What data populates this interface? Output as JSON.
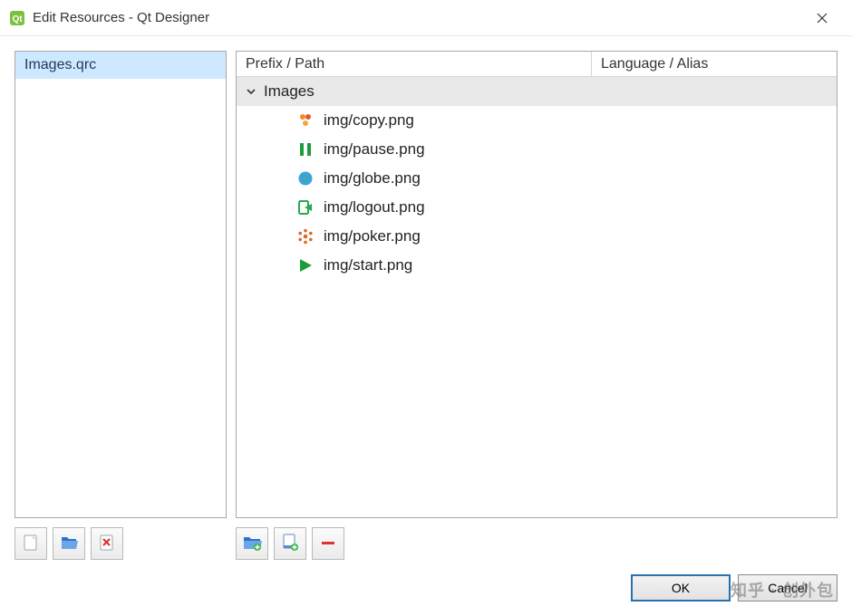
{
  "window": {
    "title": "Edit Resources - Qt Designer"
  },
  "left_panel": {
    "qrc_file": "Images.qrc"
  },
  "right_panel": {
    "headers": {
      "prefix_path": "Prefix / Path",
      "language_alias": "Language / Alias"
    },
    "prefix": "Images",
    "items": [
      {
        "icon": "copy-icon",
        "path": "img/copy.png"
      },
      {
        "icon": "pause-icon",
        "path": "img/pause.png"
      },
      {
        "icon": "globe-icon",
        "path": "img/globe.png"
      },
      {
        "icon": "logout-icon",
        "path": "img/logout.png"
      },
      {
        "icon": "poker-icon",
        "path": "img/poker.png"
      },
      {
        "icon": "start-icon",
        "path": "img/start.png"
      }
    ]
  },
  "left_tools": [
    {
      "name": "new-qrc-button",
      "icon": "new-file-icon"
    },
    {
      "name": "open-qrc-button",
      "icon": "open-file-icon"
    },
    {
      "name": "remove-qrc-button",
      "icon": "remove-file-icon"
    }
  ],
  "right_tools": [
    {
      "name": "add-prefix-button",
      "icon": "add-folder-icon"
    },
    {
      "name": "add-file-button",
      "icon": "add-file-icon"
    },
    {
      "name": "remove-item-button",
      "icon": "minus-icon"
    }
  ],
  "buttons": {
    "ok": "OK",
    "cancel": "Cancel"
  },
  "watermark": "知乎 · 创外包"
}
